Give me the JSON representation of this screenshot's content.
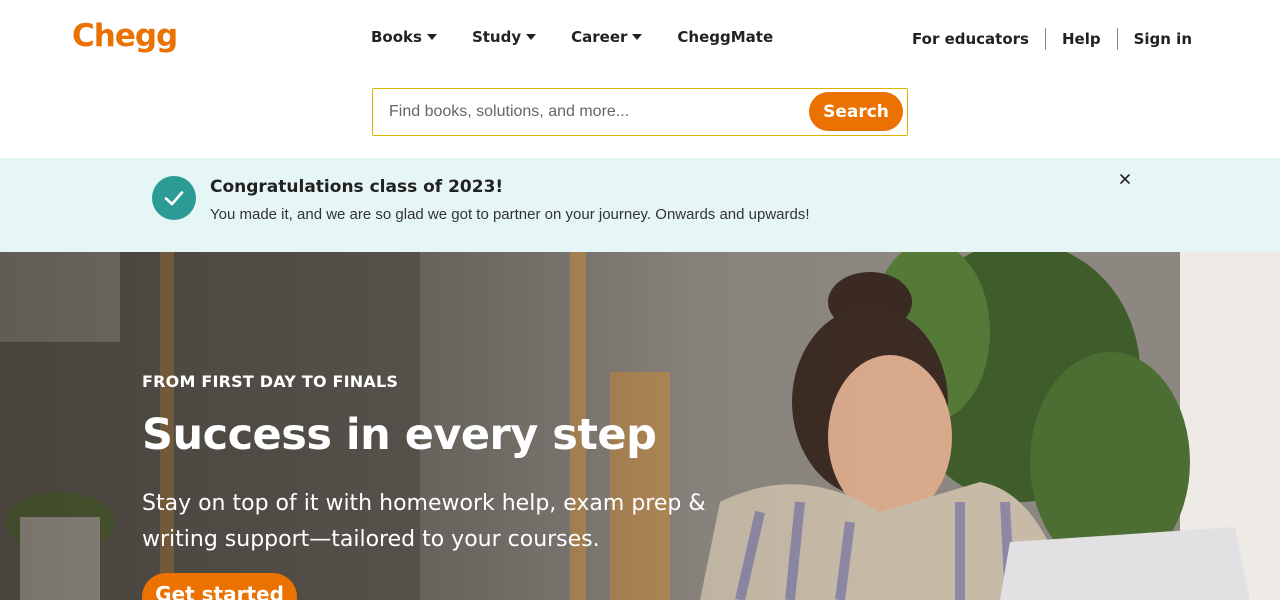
{
  "header": {
    "logo": "Chegg",
    "nav": [
      {
        "label": "Books",
        "has_dropdown": true
      },
      {
        "label": "Study",
        "has_dropdown": true
      },
      {
        "label": "Career",
        "has_dropdown": true
      },
      {
        "label": "CheggMate",
        "has_dropdown": false
      }
    ],
    "right_links": [
      "For educators",
      "Help",
      "Sign in"
    ]
  },
  "search": {
    "placeholder": "Find books, solutions, and more...",
    "value": "",
    "button_label": "Search"
  },
  "banner": {
    "title": "Congratulations class of 2023!",
    "text": "You made it, and we are so glad we got to partner on your journey. Onwards and upwards!",
    "icon": "check-icon",
    "close_icon": "close-icon"
  },
  "hero": {
    "eyebrow": "FROM FIRST DAY TO FINALS",
    "headline": "Success in every step",
    "subline": "Stay on top of it with homework help, exam prep & writing support—tailored to your courses.",
    "cta_label": "Get started"
  },
  "colors": {
    "brand_orange": "#eb7100",
    "banner_bg": "#e6f6f6",
    "check_teal": "#2a9c95",
    "search_border": "#d9b400"
  }
}
